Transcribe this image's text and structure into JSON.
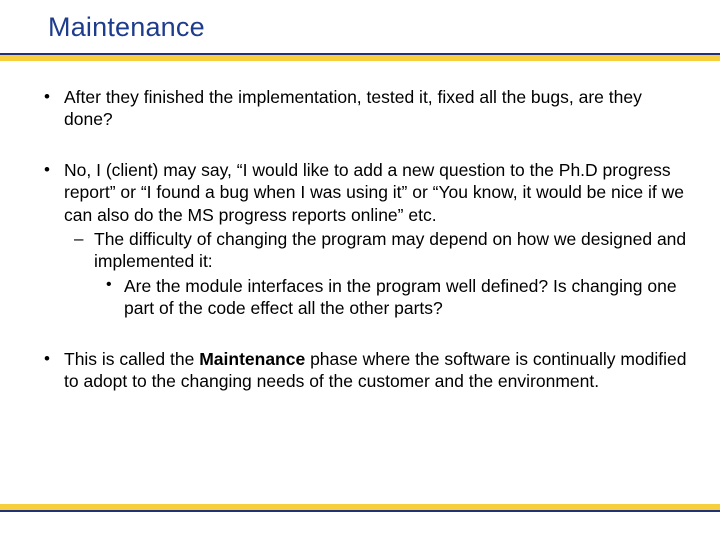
{
  "title": "Maintenance",
  "bullets": {
    "b1": "After they finished the implementation, tested it, fixed all the bugs, are they done?",
    "b2": "No, I (client) may say, “I would like to add a new question to the Ph.D progress report” or “I found a bug when I was using it” or “You know, it would be nice if we can also do the MS progress reports online” etc.",
    "b2_sub1": "The difficulty of changing the program may depend on how we designed and implemented it:",
    "b2_sub1_sub1": "Are the module interfaces in the program well defined? Is changing one part of the code effect all the other parts?",
    "b3_pre": "This is called the ",
    "b3_bold": "Maintenance",
    "b3_post": " phase where the software is continually modified to adopt to the changing needs of the customer and the environment."
  },
  "colors": {
    "title": "#1e3c8c",
    "rule_blue": "#20307a",
    "rule_gold": "#f7cf3d"
  }
}
